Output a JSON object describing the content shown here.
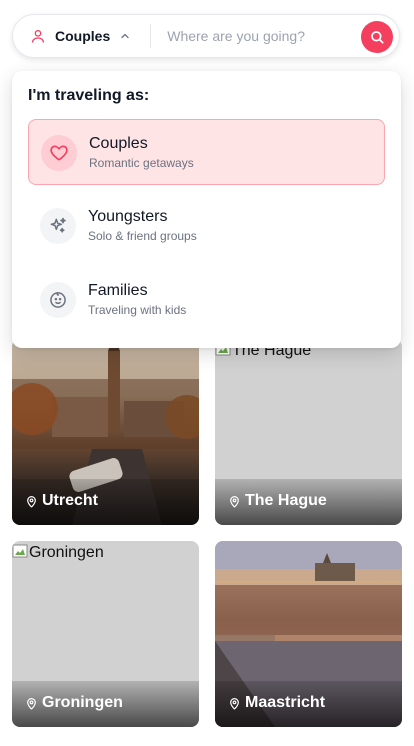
{
  "search": {
    "traveler_label": "Couples",
    "destination_placeholder": "Where are you going?",
    "destination_value": ""
  },
  "dropdown": {
    "title": "I'm traveling as:",
    "options": [
      {
        "title": "Couples",
        "subtitle": "Romantic getaways",
        "icon": "heart-icon",
        "selected": true
      },
      {
        "title": "Youngsters",
        "subtitle": "Solo & friend groups",
        "icon": "sparkles-icon",
        "selected": false
      },
      {
        "title": "Families",
        "subtitle": "Traveling with kids",
        "icon": "baby-face-icon",
        "selected": false
      }
    ]
  },
  "destinations": [
    {
      "name": "Utrecht",
      "image_alt": "",
      "image_loaded": true
    },
    {
      "name": "The Hague",
      "image_alt": "The Hague",
      "image_loaded": false
    },
    {
      "name": "Groningen",
      "image_alt": "Groningen",
      "image_loaded": false
    },
    {
      "name": "Maastricht",
      "image_alt": "",
      "image_loaded": true
    }
  ],
  "colors": {
    "accent": "#f43f5e",
    "selected_bg": "#ffe4e6",
    "selected_border": "#fda4af",
    "muted_text": "#6b7280"
  }
}
